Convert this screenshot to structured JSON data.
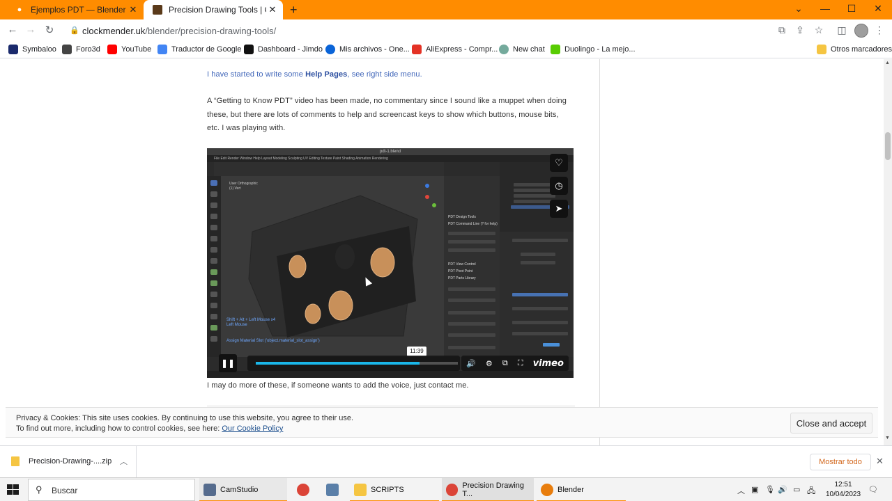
{
  "browser": {
    "tabs": [
      {
        "title": "Ejemplos PDT — Blender Manual",
        "close": "✕"
      },
      {
        "title": "Precision Drawing Tools | Clockm",
        "close": "✕"
      }
    ],
    "new_tab": "+",
    "window_controls": {
      "chevron": "⌄",
      "minimize": "—",
      "maximize": "☐",
      "close": "✕"
    },
    "nav": {
      "back": "←",
      "forward": "→",
      "reload": "↻"
    },
    "url_domain": "clockmender.uk",
    "url_path": "/blender/precision-drawing-tools/",
    "toolbar_icons": [
      "translate-icon",
      "share-icon",
      "star-icon",
      "sidebar-icon",
      "profile-icon",
      "menu-icon"
    ],
    "bookmarks": [
      {
        "label": "Symbaloo",
        "color": "#1a2a6c"
      },
      {
        "label": "Foro3d",
        "color": "#444444"
      },
      {
        "label": "YouTube",
        "color": "#ff0000"
      },
      {
        "label": "Traductor de Google",
        "color": "#4285f4"
      },
      {
        "label": "Dashboard - Jimdo",
        "color": "#111111"
      },
      {
        "label": "Mis archivos - One...",
        "color": "#0a64d8"
      },
      {
        "label": "AliExpress - Compr...",
        "color": "#e43225"
      },
      {
        "label": "New chat",
        "color": "#74aa9c"
      },
      {
        "label": "Duolingo - La mejo...",
        "color": "#58cc02"
      }
    ],
    "other_bookmarks": "Otros marcadores"
  },
  "article": {
    "p1_pre": "I have started to write some ",
    "p1_bold": "Help Pages",
    "p1_post": ", see right side menu.",
    "p2": "A “Getting to Know PDT” video has been made, no commentary since I sound like a muppet when doing these, but there are lots of comments to help and screencast keys to show which buttons, mouse bits, etc. I was playing with.",
    "p3": "I may do more of these, if someone wants to add the voice, just contact me."
  },
  "video": {
    "file_title": "pdt-1.blend",
    "menu": "File   Edit   Render   Window   Help          Layout   Modeling   Sculpting   UV Editing   Texture Paint   Shading   Animation   Rendering",
    "viewport_label_1": "User Orthographic",
    "viewport_label_2": "(1) Vert",
    "shortcut_1": "Shift + Alt + Left Mouse x4",
    "shortcut_2": "Left Mouse",
    "assign_text": "Assign Material Slot (’object.material_slot_assign’)",
    "npanel": [
      "PDT Design Tools",
      "PDT Command Line (? for help)",
      "PDT View Control",
      "PDT Pivot Point",
      "PDT Parts Library"
    ],
    "time": "11:39",
    "progress": 0.81,
    "logo": "vimeo",
    "side_icons": [
      "heart-icon",
      "clock-icon",
      "send-icon"
    ]
  },
  "cookie": {
    "line1": "Privacy & Cookies: This site uses cookies. By continuing to use this website, you agree to their use.",
    "line2": "To find out more, including how to control cookies, see here: ",
    "link": "Our Cookie Policy",
    "button": "Close and accept"
  },
  "downloads": {
    "file": "Precision-Drawing-....zip",
    "show_all": "Mostrar todo",
    "close": "✕"
  },
  "taskbar": {
    "search": "Buscar",
    "apps": [
      {
        "label": "CamStudio",
        "color": "#556b8d"
      },
      {
        "label": "",
        "color": "#db4437"
      },
      {
        "label": "",
        "color": "#5a7fa8"
      },
      {
        "label": "SCRIPTS",
        "color": "#f5c542"
      },
      {
        "label": "Precision Drawing T...",
        "color": "#db4437"
      },
      {
        "label": "Blender",
        "color": "#e87d0d"
      }
    ],
    "time": "12:51",
    "date": "10/04/2023"
  }
}
